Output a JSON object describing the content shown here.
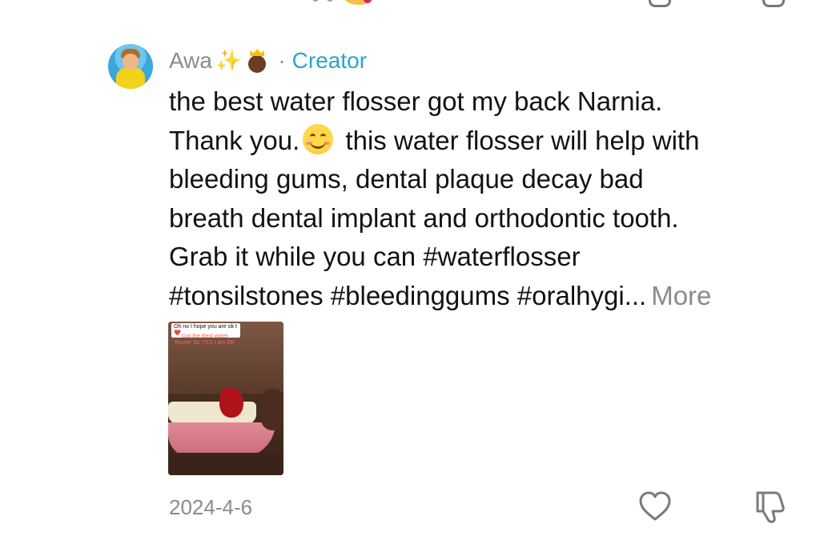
{
  "comment": {
    "username": "Awa",
    "badge_separator": "·",
    "badge_label": "Creator",
    "text_lines": [
      "the best water flosser got my back Narnia.",
      "Thank you.",
      " this water flosser will help with",
      "bleeding gums, dental plaque decay bad",
      "breath dental implant and orthodontic tooth.",
      "Grab it while you can #waterflosser",
      "#tonsilstones #bleedinggums #oralhygi..."
    ],
    "more_label": "More",
    "attachment": {
      "caption_top": "Oh no I hope you are ok t ❤️",
      "caption_overlay": "Got the Best water flosser So YES I am OK"
    },
    "date": "2024-4-6"
  },
  "icons": {
    "avatar": "avatar",
    "sparkle": "sparkles-icon",
    "queen": "princess-emoji-icon",
    "smile": "smiling-face-icon",
    "like": "heart-icon",
    "dislike": "thumbs-down-icon"
  },
  "colors": {
    "username": "#8a8a8e",
    "creator": "#2aa4cf",
    "text": "#121212",
    "secondary": "#8a8a8e"
  }
}
